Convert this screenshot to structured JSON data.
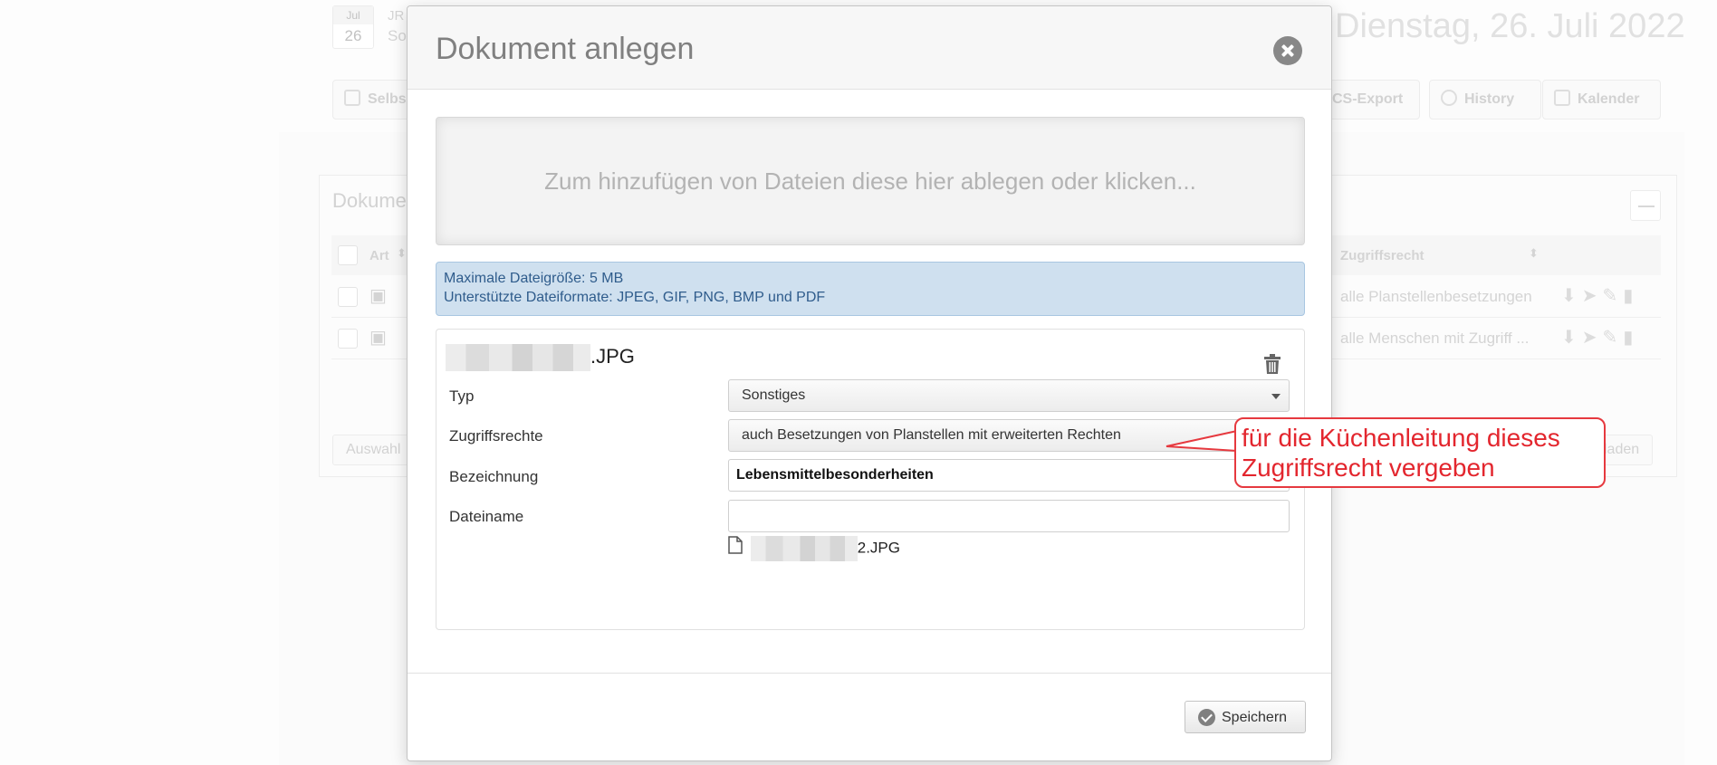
{
  "background": {
    "date_badge": {
      "month": "Jul",
      "day": "26"
    },
    "header_fragments": [
      "JR",
      "So"
    ],
    "header_date": "Dienstag, 26. Juli 2022",
    "toolbar_buttons": [
      "Selbs",
      "CS-Export",
      "History",
      "Kalender"
    ],
    "panel_title": "Dokume",
    "minimize_label": "—",
    "table": {
      "headers": [
        "Art",
        "Zugriffsrecht"
      ],
      "rows": [
        {
          "zugriffsrecht": "alle Planstellenbesetzungen"
        },
        {
          "zugriffsrecht": "alle Menschen mit Zugriff ..."
        }
      ]
    },
    "bottom_buttons": [
      "Auswahl",
      "laden"
    ]
  },
  "modal": {
    "title": "Dokument anlegen",
    "dropzone_text": "Zum hinzufügen von Dateien diese hier ablegen oder klicken...",
    "info": {
      "max_size": "Maximale Dateigröße: 5 MB",
      "formats": "Unterstützte Dateiformate: JPEG, GIF, PNG, BMP und PDF"
    },
    "file": {
      "extension": ".JPG",
      "fields": {
        "typ": {
          "label": "Typ",
          "value": "Sonstiges"
        },
        "zugriffsrechte": {
          "label": "Zugriffsrechte",
          "value": "auch Besetzungen von Planstellen mit erweiterten Rechten"
        },
        "bezeichnung": {
          "label": "Bezeichnung",
          "value": "Lebensmittelbesonderheiten"
        },
        "dateiname": {
          "label": "Dateiname",
          "value": "",
          "file_suffix": "2.JPG"
        }
      }
    },
    "save_label": "Speichern"
  },
  "annotation": {
    "text_line1": "für die Küchenleitung dieses",
    "text_line2": "Zugriffsrecht vergeben",
    "color": "#e3262e"
  }
}
